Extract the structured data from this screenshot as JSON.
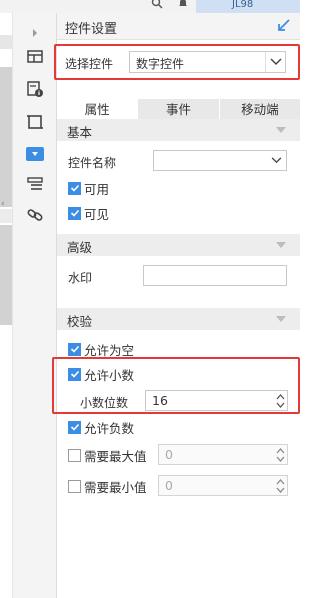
{
  "topbar": {
    "user_tag": "JL98",
    "search_icon": "search-icon",
    "bell_icon": "bell-icon"
  },
  "toolbar": {
    "icons": [
      "chevron-right-icon",
      "form-layout-icon",
      "form-info-icon",
      "frame-icon",
      "widget-dropdown-icon",
      "list-layout-icon",
      "link-icon"
    ],
    "active_index": 4,
    "accent": "#3c8ee5"
  },
  "panel": {
    "title": "控件设置",
    "select_control": {
      "label": "选择控件",
      "value": "数字控件"
    },
    "tabs": [
      {
        "label": "属性",
        "active": true
      },
      {
        "label": "事件",
        "active": false
      },
      {
        "label": "移动端",
        "active": false
      }
    ],
    "basic": {
      "title": "基本",
      "control_name": {
        "label": "控件名称",
        "value": ""
      },
      "enabled": {
        "label": "可用",
        "checked": true
      },
      "visible": {
        "label": "可见",
        "checked": true
      }
    },
    "advanced": {
      "title": "高级",
      "watermark": {
        "label": "水印",
        "value": ""
      }
    },
    "validation": {
      "title": "校验",
      "allow_empty": {
        "label": "允许为空",
        "checked": true
      },
      "allow_decimal": {
        "label": "允许小数",
        "checked": true
      },
      "decimal_places": {
        "label": "小数位数",
        "value": "16"
      },
      "allow_negative": {
        "label": "允许负数",
        "checked": true
      },
      "max_value": {
        "label": "需要最大值",
        "checked": false,
        "value": "0"
      },
      "min_value": {
        "label": "需要最小值",
        "checked": false,
        "value": "0"
      }
    }
  },
  "highlight_color": "#e53935"
}
